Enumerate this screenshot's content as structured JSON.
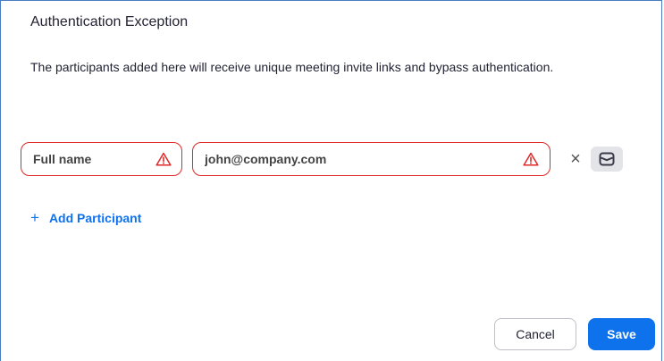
{
  "dialog": {
    "title": "Authentication Exception",
    "description": "The participants added here will receive unique meeting invite links and bypass authentication."
  },
  "participant": {
    "name_placeholder": "Full name",
    "name_value": "",
    "email_placeholder": "john@company.com",
    "email_value": "",
    "remove_symbol": "×"
  },
  "add_participant": {
    "plus_symbol": "+",
    "label": "Add Participant"
  },
  "footer": {
    "cancel_label": "Cancel",
    "save_label": "Save"
  },
  "colors": {
    "accent": "#0e72ed",
    "error": "#e02828"
  },
  "icons": {
    "warning": "warning-triangle-icon",
    "remove": "close-icon",
    "mail": "envelope-icon"
  }
}
